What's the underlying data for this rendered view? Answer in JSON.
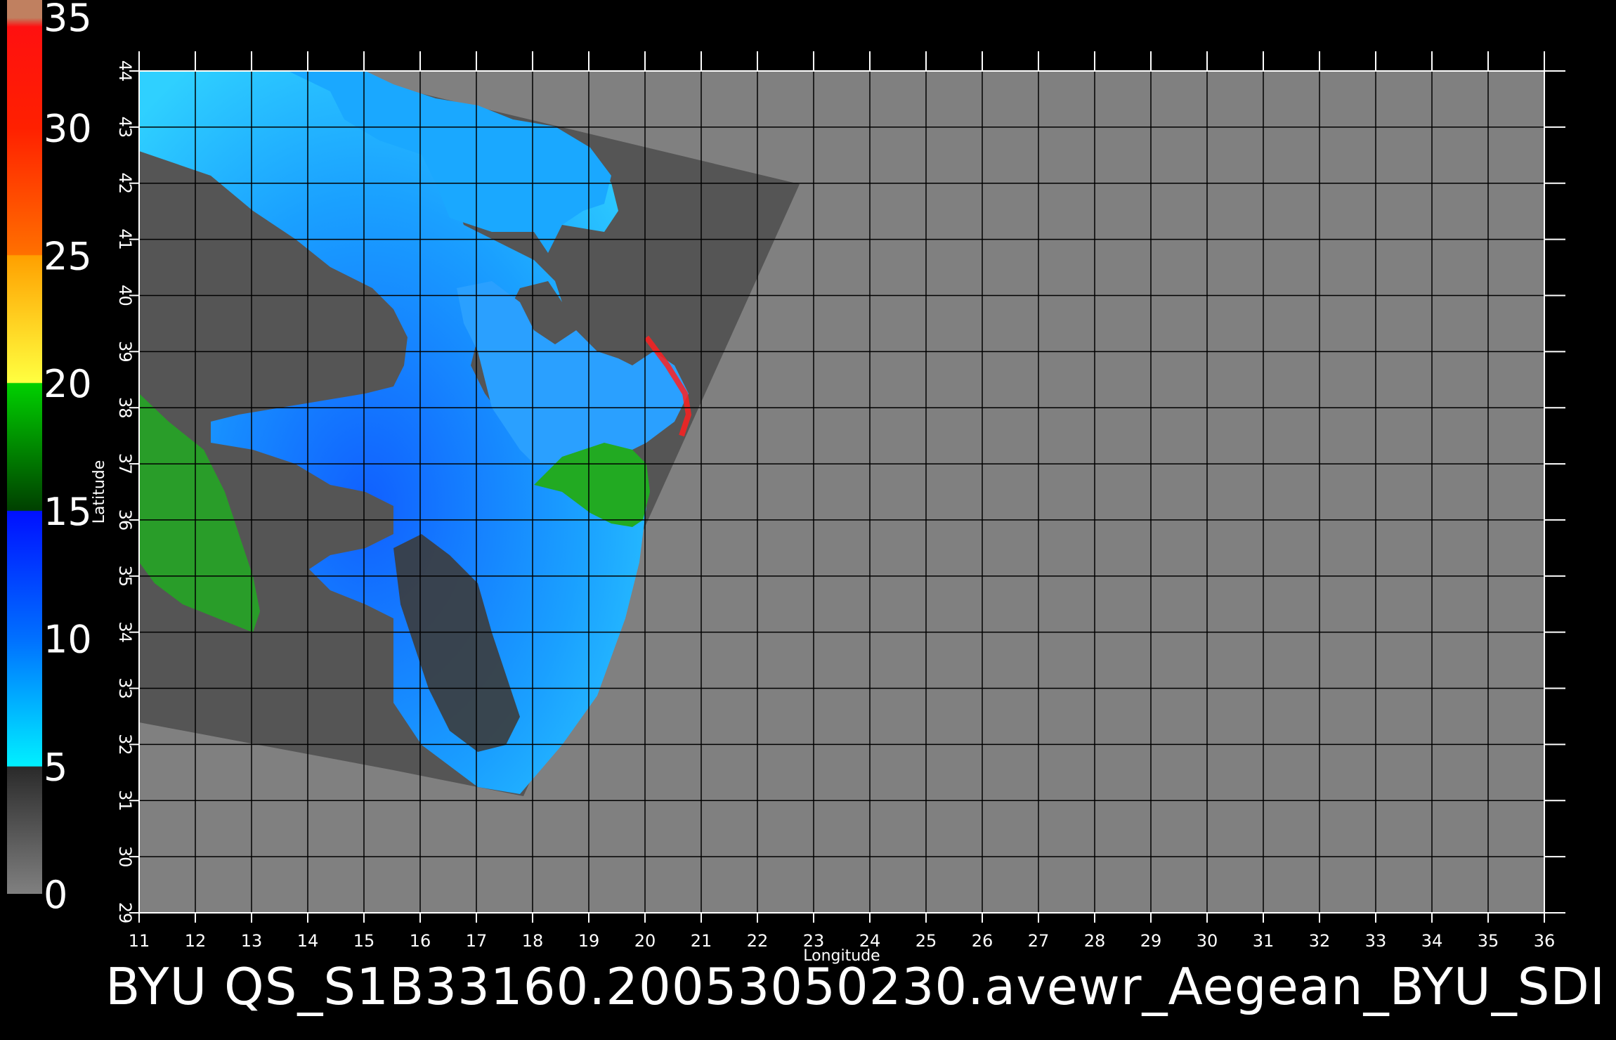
{
  "footer": {
    "title": "BYU  QS_S1B33160.20053050230.avewr_Aegean_BYU_SDI"
  },
  "chart_data": {
    "type": "map",
    "xlabel": "Longitude",
    "ylabel": "Latitude",
    "xlim": [
      11,
      36
    ],
    "ylim": [
      29,
      44
    ],
    "x_ticks": [
      11,
      12,
      13,
      14,
      15,
      16,
      17,
      18,
      19,
      20,
      21,
      22,
      23,
      24,
      25,
      26,
      27,
      28,
      29,
      30,
      31,
      32,
      33,
      34,
      35,
      36
    ],
    "y_ticks": [
      29,
      30,
      31,
      32,
      33,
      34,
      35,
      36,
      37,
      38,
      39,
      40,
      41,
      42,
      43,
      44
    ],
    "grid": true,
    "colorbar": {
      "labels": [
        "35",
        "30",
        "25",
        "20",
        "15",
        "10",
        "5",
        "0"
      ],
      "values": [
        35,
        30,
        25,
        20,
        15,
        10,
        5,
        0
      ],
      "range": [
        0,
        35
      ],
      "colors": {
        "0": "#808080",
        "5": "#2a2a2a",
        "5_top": "#00f0ff",
        "10": "#0080ff",
        "15": "#0000ff",
        "15_top": "#005000",
        "20": "#00d000",
        "20_top": "#ffff00",
        "25": "#ffa000",
        "25_top": "#ff6000",
        "30": "#ff0000",
        "35": "#c08060"
      }
    },
    "colors": {
      "land": "#555555",
      "no_data": "#808080",
      "grid": "#000000",
      "sea_low": "#0a8cff",
      "sea_mid": "#0055ff",
      "sea_calm": "#3a3a3a",
      "wind_high": "#22bb22"
    }
  }
}
